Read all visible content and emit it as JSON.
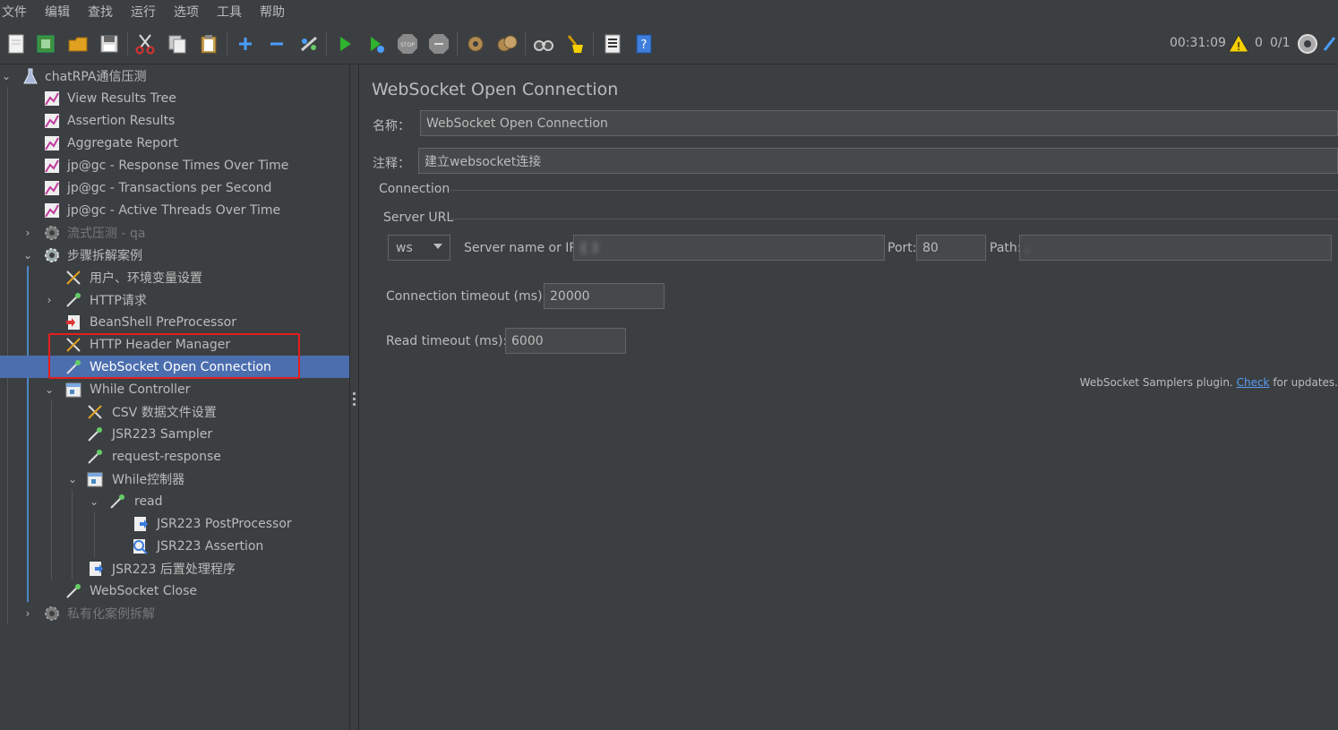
{
  "menu": [
    "文件",
    "编辑",
    "查找",
    "运行",
    "选项",
    "工具",
    "帮助"
  ],
  "toolbar": {
    "icons": [
      "new-icon",
      "templates-icon",
      "open-icon",
      "save-icon",
      "cut-icon",
      "copy-icon",
      "paste-icon",
      "expand-icon",
      "collapse-icon",
      "toggle-icon",
      "start-icon",
      "start-no-pause-icon",
      "stop-icon",
      "shutdown-icon",
      "clear-icon",
      "clear-all-icon",
      "search-icon",
      "reset-search-icon",
      "function-helper-icon",
      "help-icon"
    ],
    "elapsed_time": "00:31:09",
    "warnings": "0",
    "threads": "0/1"
  },
  "tree": {
    "items": [
      {
        "label": "chatRPA通信压测"
      },
      {
        "label": "View Results Tree"
      },
      {
        "label": "Assertion Results"
      },
      {
        "label": "Aggregate Report"
      },
      {
        "label": "jp@gc - Response Times Over Time"
      },
      {
        "label": "jp@gc - Transactions per Second"
      },
      {
        "label": "jp@gc - Active Threads Over Time"
      },
      {
        "label": "流式压测 - qa"
      },
      {
        "label": "步骤拆解案例"
      },
      {
        "label": "用户、环境变量设置"
      },
      {
        "label": "HTTP请求"
      },
      {
        "label": "BeanShell PreProcessor"
      },
      {
        "label": "HTTP Header Manager"
      },
      {
        "label": "WebSocket Open Connection"
      },
      {
        "label": "While Controller"
      },
      {
        "label": "CSV 数据文件设置"
      },
      {
        "label": "JSR223 Sampler"
      },
      {
        "label": "request-response"
      },
      {
        "label": "While控制器"
      },
      {
        "label": "read"
      },
      {
        "label": "JSR223 PostProcessor"
      },
      {
        "label": "JSR223 Assertion"
      },
      {
        "label": "JSR223 后置处理程序"
      },
      {
        "label": "WebSocket Close"
      },
      {
        "label": "私有化案例拆解"
      }
    ]
  },
  "panel": {
    "title": "WebSocket Open Connection",
    "name_label": "名称：",
    "name_value": "WebSocket Open Connection",
    "comment_label": "注释：",
    "comment_value": "建立websocket连接",
    "connection_section": "Connection",
    "server_url_section": "Server URL",
    "protocol": "ws",
    "server_label": "Server name or IP:",
    "server_value": "{                }",
    "port_label": "Port:",
    "port_value": "80",
    "path_label": "Path:",
    "path_value": ",                            ",
    "conn_timeout_label": "Connection timeout (ms):",
    "conn_timeout_value": "20000",
    "read_timeout_label": "Read timeout (ms):",
    "read_timeout_value": "6000",
    "plugin_note_prefix": "WebSocket Samplers plugin.",
    "plugin_note_link": "Check",
    "plugin_note_suffix": "for updates."
  }
}
